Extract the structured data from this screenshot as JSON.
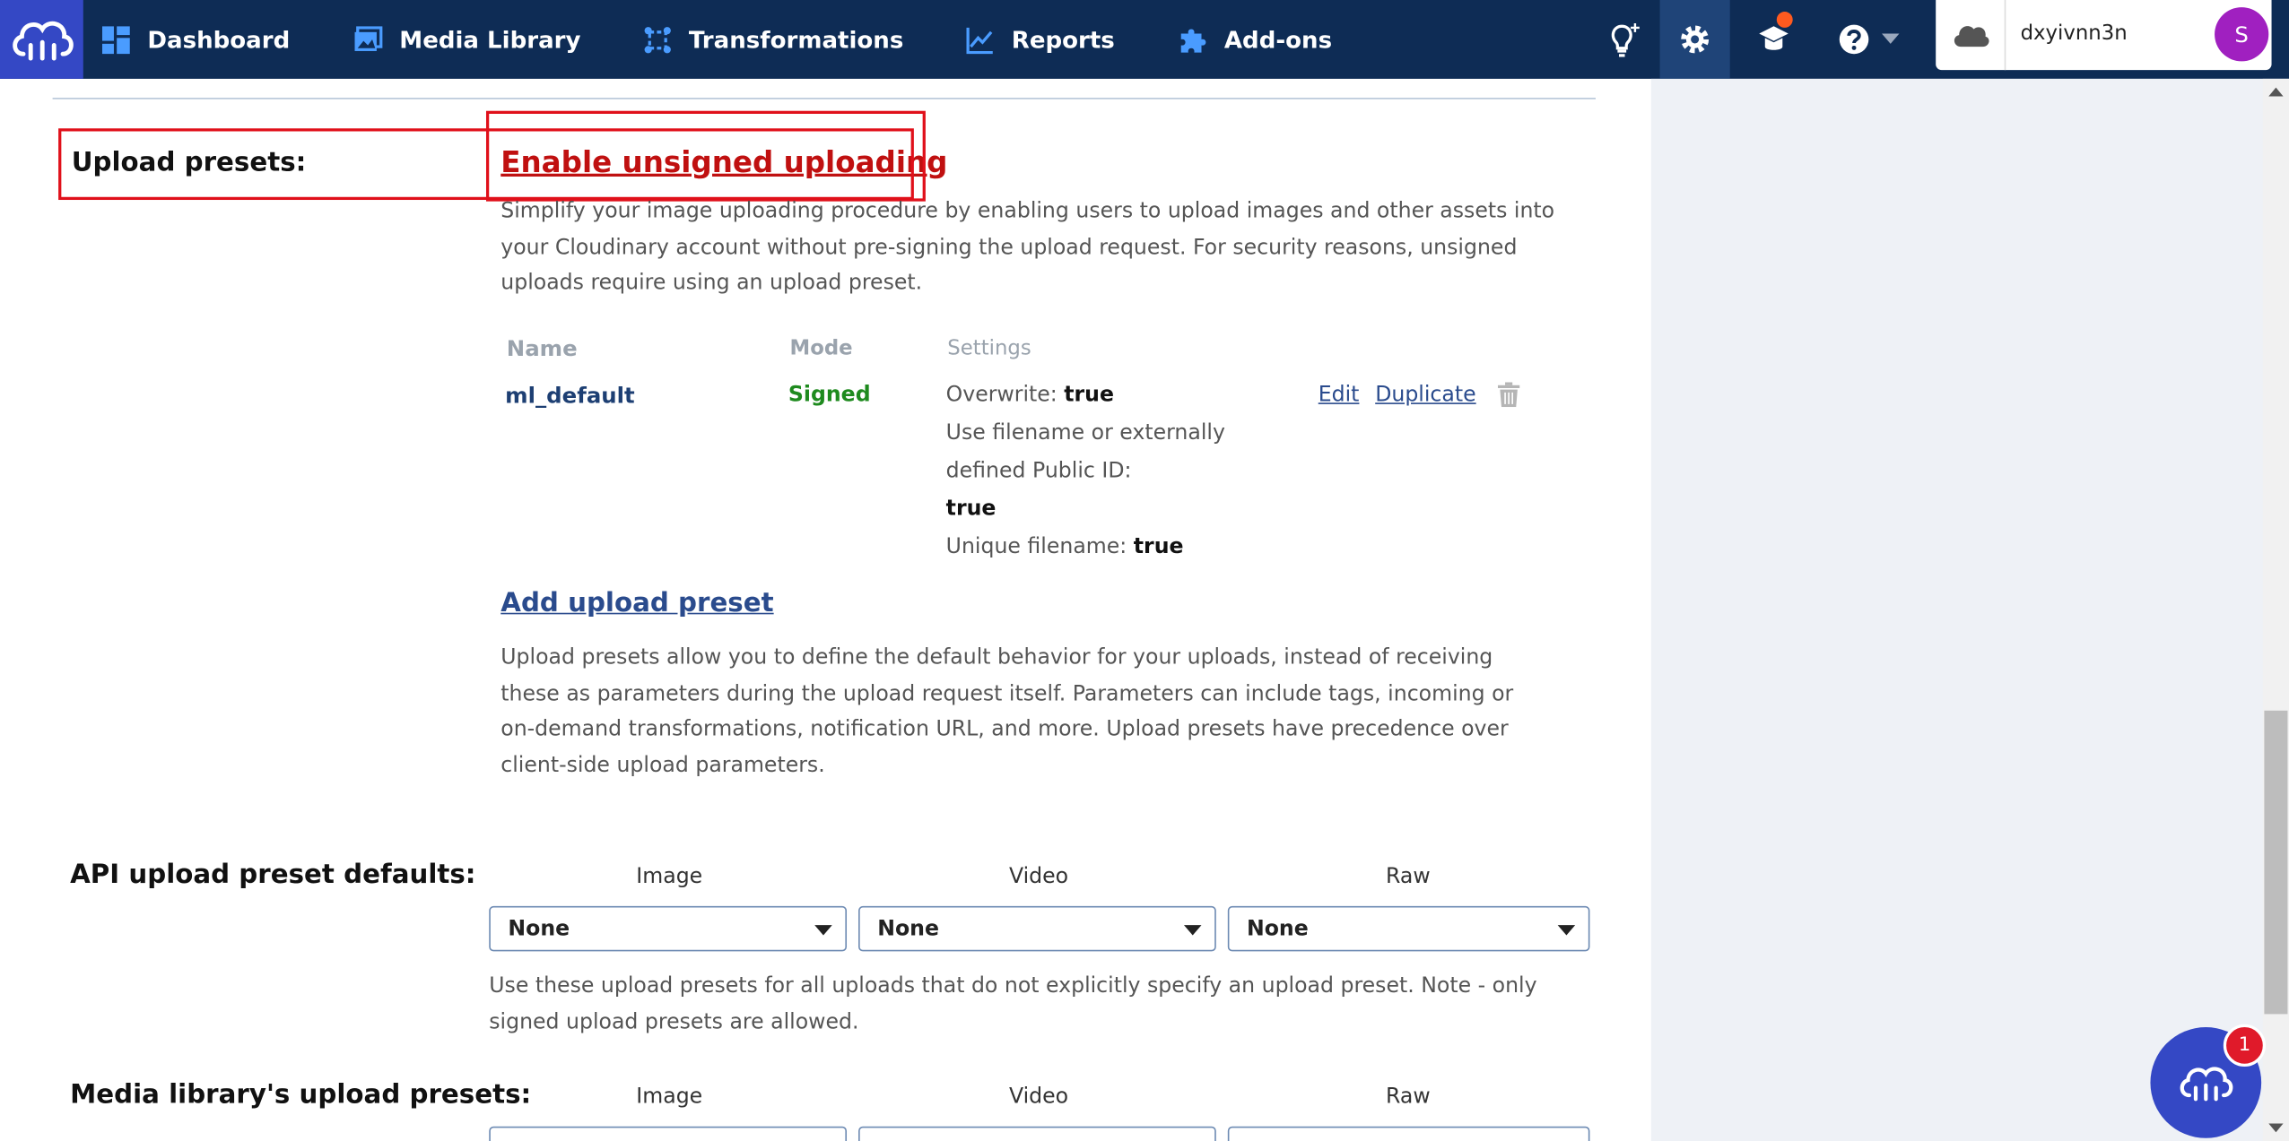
{
  "nav": {
    "items": [
      {
        "label": "Dashboard",
        "icon": "dashboard-icon"
      },
      {
        "label": "Media Library",
        "icon": "media-library-icon"
      },
      {
        "label": "Transformations",
        "icon": "transformations-icon"
      },
      {
        "label": "Reports",
        "icon": "reports-icon"
      },
      {
        "label": "Add-ons",
        "icon": "puzzle-icon"
      }
    ]
  },
  "account": {
    "name": "dxyivnn3n",
    "avatar_letter": "S"
  },
  "upload_presets": {
    "label": "Upload presets:",
    "enable_link": "Enable unsigned uploading",
    "enable_desc": "Simplify your image uploading procedure by enabling users to upload images and other assets into your Cloudinary account without pre-signing the upload request. For security reasons, unsigned uploads require using an upload preset.",
    "table": {
      "headers": {
        "name": "Name",
        "mode": "Mode",
        "settings": "Settings"
      },
      "rows": [
        {
          "name": "ml_default",
          "mode": "Signed",
          "settings": [
            {
              "key": "Overwrite:",
              "value": "true"
            },
            {
              "key": "Use filename or externally defined Public ID:",
              "value": "true"
            },
            {
              "key": "Unique filename:",
              "value": "true"
            }
          ],
          "edit": "Edit",
          "duplicate": "Duplicate"
        }
      ]
    },
    "add_link": "Add upload preset",
    "add_desc": "Upload presets allow you to define the default behavior for your uploads, instead of receiving these as parameters during the upload request itself. Parameters can include tags, incoming or on-demand transformations, notification URL, and more. Upload presets have precedence over client-side upload parameters."
  },
  "api_defaults": {
    "label": "API upload preset defaults:",
    "columns": [
      "Image",
      "Video",
      "Raw"
    ],
    "values": [
      "None",
      "None",
      "None"
    ],
    "note": "Use these upload presets for all uploads that do not explicitly specify an upload preset. Note - only signed upload presets are allowed."
  },
  "media_library": {
    "label": "Media library's upload presets:",
    "columns": [
      "Image",
      "Video",
      "Raw"
    ]
  },
  "chat": {
    "badge": "1"
  },
  "colors": {
    "nav_bg": "#0e2c55",
    "brand": "#3448c5",
    "highlight_red": "#e0101a",
    "signed_green": "#1e8a1e",
    "link_blue": "#2a4b8d"
  }
}
